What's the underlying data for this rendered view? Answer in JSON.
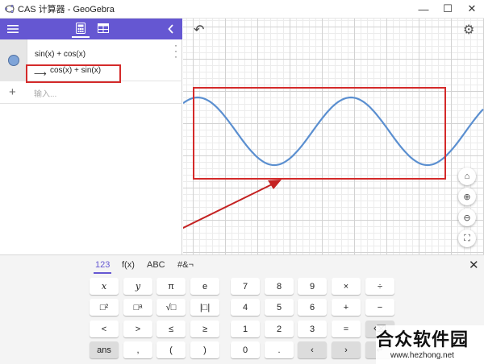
{
  "window": {
    "title": "CAS 计算器 - GeoGebra",
    "brand_color": "#6557d2",
    "minimize": "—",
    "maximize": "☐",
    "close": "✕"
  },
  "toolbar": {
    "menu_icon": "hamburger-menu-icon",
    "tab_calculator": "calculator-icon",
    "tab_table": "table-icon",
    "collapse_icon": "chevron-left-icon"
  },
  "algebra": {
    "input_expression": "sin(x) + cos(x)",
    "output_arrow": "⟶",
    "output_expression": "cos(x) + sin(x)",
    "new_input_placeholder": "输入..."
  },
  "graphics": {
    "undo_icon": "undo-icon",
    "settings_icon": "gear-icon",
    "side_buttons": [
      "home-icon",
      "zoom-in-icon",
      "zoom-out-icon",
      "fullscreen-icon"
    ],
    "curve_color": "#5b8fd0",
    "annotation_color": "#d42a2a"
  },
  "keyboard": {
    "tabs": [
      "123",
      "f(x)",
      "ABC",
      "#&¬"
    ],
    "close": "✕",
    "rows": [
      [
        "x",
        "y",
        "π",
        "e",
        "7",
        "8",
        "9",
        "×",
        "÷"
      ],
      [
        "□²",
        "□ᵃ",
        "√□",
        "|□|",
        "4",
        "5",
        "6",
        "+",
        "−"
      ],
      [
        "<",
        ">",
        "≤",
        "≥",
        "1",
        "2",
        "3",
        "=",
        "⌫"
      ],
      [
        "ans",
        ",",
        "(",
        ")",
        "0",
        ".",
        "‹",
        "›",
        "↵"
      ]
    ]
  },
  "watermark": {
    "logo_text": "合众软件园",
    "url": "www.hezhong.net"
  }
}
